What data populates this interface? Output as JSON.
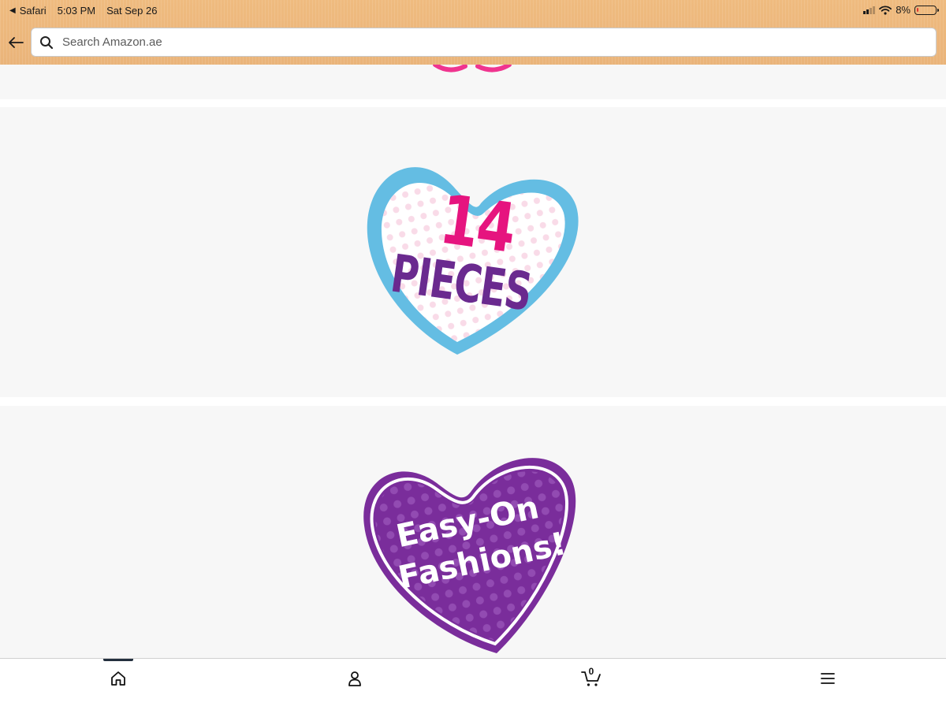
{
  "status_bar": {
    "back_app": "Safari",
    "time": "5:03 PM",
    "date": "Sat Sep 26",
    "battery": "8%",
    "battery_level": 0.08
  },
  "search": {
    "placeholder": "Search Amazon.ae"
  },
  "images": [
    {
      "line1": "14",
      "line2": "PIECES"
    },
    {
      "line1": "Easy-On",
      "line2": "Fashions!"
    }
  ],
  "tabbar": {
    "cart_count": "0",
    "active_tab": "home"
  },
  "colors": {
    "toolbar": "#eab47a",
    "heart_blue": "#64bde3",
    "pink": "#e6147f",
    "purple": "#6a2a8f",
    "heart_purple": "#7a2d9b"
  }
}
